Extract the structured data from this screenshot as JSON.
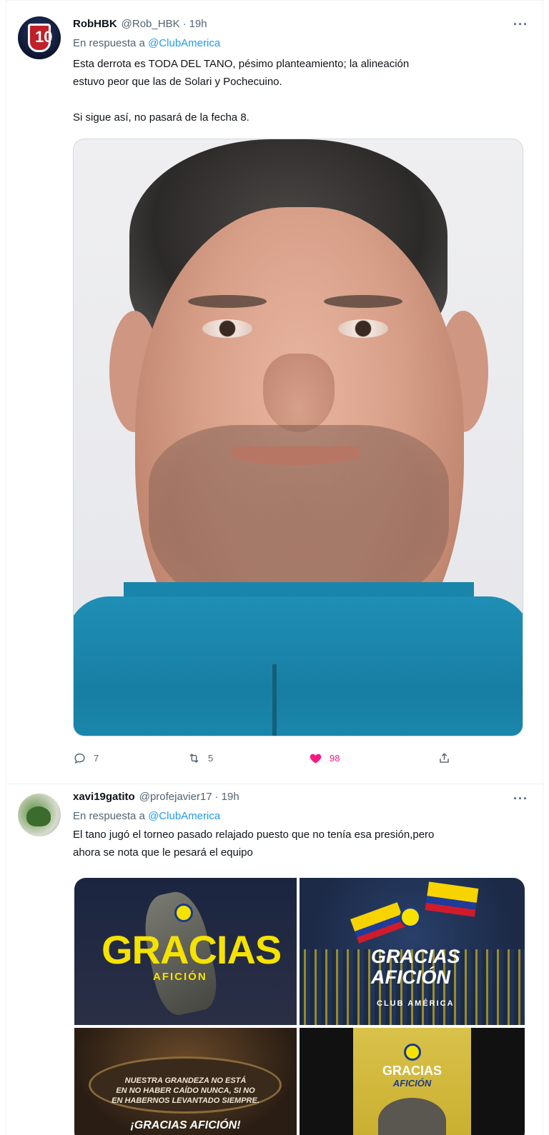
{
  "tweets": [
    {
      "display_name": "RobHBK",
      "handle": "@Rob_HBK",
      "time": "19h",
      "reply_prefix": "En respuesta a",
      "reply_to": "@ClubAmerica",
      "text": "Esta derrota es TODA DEL TANO, pésimo planteamiento; la alineación\nestuvo peor que las de Solari y Pochecuino.\n\nSi sigue así, no pasará de la fecha 8.",
      "more": "···",
      "avatar_icon": "team-logo-icon",
      "replies": "7",
      "retweets": "5",
      "likes": "98",
      "liked": true,
      "like_color": "#f91880"
    },
    {
      "display_name": "xavi19gatito",
      "handle": "@profejavier17",
      "time": "19h",
      "reply_prefix": "En respuesta a",
      "reply_to": "@ClubAmerica",
      "text": "El tano jugó el torneo pasado relajado puesto que no tenía esa presión,pero\nahora se nota que le pesará el equipo",
      "more": "···",
      "avatar_icon": "cat-photo-icon"
    }
  ],
  "grid_images": [
    {
      "word": "GRACIAS",
      "sub": "AFICIÓN"
    },
    {
      "line1": "GRACIAS",
      "line2": "AFICIÓN",
      "line3": "CLUB AMÉRICA"
    },
    {
      "line1": "NUESTRA GRANDEZA NO ESTÁ",
      "line2": "EN NO HABER CAÍDO NUNCA, SI NO",
      "line3": "EN HABERNOS LEVANTADO SIEMPRE.",
      "line4": "¡GRACIAS AFICIÓN!"
    },
    {
      "line1": "GRACIAS",
      "line2": "AFICIÓN"
    }
  ],
  "colors": {
    "link": "#1d9bf0",
    "secondary_text": "#536471",
    "border": "#eff3f4",
    "brand_yellow": "#f5e200"
  }
}
